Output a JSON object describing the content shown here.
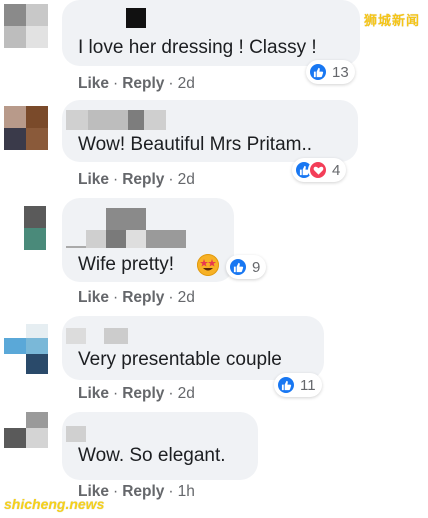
{
  "watermark_top": "狮城新闻",
  "watermark_bottom": "shicheng.news",
  "colors": {
    "bubble": "#f0f2f5",
    "meta_text": "#65676b",
    "like_blue": "#1877f2",
    "love_red": "#f33e58",
    "watermark": "#f5c518"
  },
  "comments": [
    {
      "text": "I love her dressing ! Classy !",
      "actions": {
        "like": "Like",
        "reply": "Reply",
        "time": "2d"
      },
      "reactions": {
        "icons": [
          "like-icon"
        ],
        "count": "13"
      }
    },
    {
      "text": "Wow! Beautiful Mrs Pritam..",
      "actions": {
        "like": "Like",
        "reply": "Reply",
        "time": "2d"
      },
      "reactions": {
        "icons": [
          "like-icon",
          "love-icon"
        ],
        "count": "4"
      }
    },
    {
      "text": "Wife pretty!",
      "emoji": "star-struck-emoji",
      "actions": {
        "like": "Like",
        "reply": "Reply",
        "time": "2d"
      },
      "reactions": {
        "icons": [
          "like-icon"
        ],
        "count": "9"
      }
    },
    {
      "text": "Very presentable couple",
      "actions": {
        "like": "Like",
        "reply": "Reply",
        "time": "2d"
      },
      "reactions": {
        "icons": [
          "like-icon"
        ],
        "count": "11"
      }
    },
    {
      "text": "Wow. So elegant.",
      "actions": {
        "like": "Like",
        "reply": "Reply",
        "time": "1h"
      },
      "reactions": null
    }
  ]
}
